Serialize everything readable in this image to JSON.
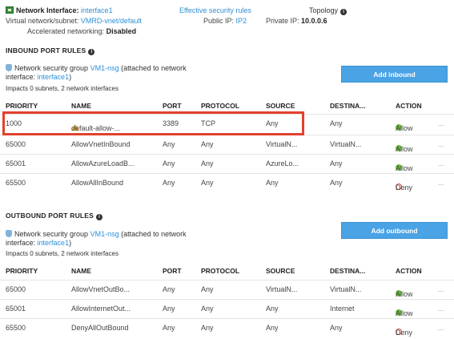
{
  "header": {
    "title_label": "Network Interface:",
    "interface_name": "interface1",
    "effective_rules_link": "Effective security rules",
    "topology_label": "Topology",
    "vnet_label": "Virtual network/subnet:",
    "vnet_value": "VMRD-vnet/default",
    "public_ip_label": "Public IP:",
    "public_ip_value": "IP2",
    "private_ip_label": "Private IP:",
    "private_ip_value": "10.0.0.6",
    "accel_label": "Accelerated networking:",
    "accel_value": "Disabled"
  },
  "inbound": {
    "title": "INBOUND PORT RULES",
    "nsg_prefix": "Network security group",
    "nsg_name": "VM1-nsg",
    "nsg_attached": "(attached to network",
    "nsg_interface_prefix": "interface:",
    "nsg_interface": "interface1",
    "nsg_close": ")",
    "impacts": "Impacts 0 subnets, 2 network interfaces",
    "add_button": "Add inbound",
    "columns": [
      "PRIORITY",
      "NAME",
      "PORT",
      "PROTOCOL",
      "SOURCE",
      "DESTINA...",
      "ACTION"
    ],
    "rows": [
      {
        "priority": "1000",
        "name": "default-allow-...",
        "port": "3389",
        "protocol": "TCP",
        "source": "Any",
        "destination": "Any",
        "action": "Allow",
        "more": "...",
        "warning": true
      },
      {
        "priority": "65000",
        "name": "AllowVnetInBound",
        "port": "Any",
        "protocol": "Any",
        "source": "VirtualN...",
        "destination": "VirtualN...",
        "action": "Allow",
        "more": "..."
      },
      {
        "priority": "65001",
        "name": "AllowAzureLoadB...",
        "port": "Any",
        "protocol": "Any",
        "source": "AzureLo...",
        "destination": "Any",
        "action": "Allow",
        "more": "..."
      },
      {
        "priority": "65500",
        "name": "AllowAllInBound",
        "port": "Any",
        "protocol": "Any",
        "source": "Any",
        "destination": "Any",
        "action": "Deny",
        "more": "..."
      }
    ]
  },
  "outbound": {
    "title": "OUTBOUND PORT RULES",
    "nsg_prefix": "Network security group",
    "nsg_name": "VM1-nsg",
    "nsg_attached": "(attached to network",
    "nsg_interface_prefix": "interface:",
    "nsg_interface": "interface1",
    "nsg_close": ")",
    "impacts": "Impacts 0 subnets, 2 network interfaces",
    "add_button": "Add outbound",
    "columns": [
      "PRIORITY",
      "NAME",
      "PORT",
      "PROTOCOL",
      "SOURCE",
      "DESTINA...",
      "ACTION"
    ],
    "rows": [
      {
        "priority": "65000",
        "name": "AllowVnetOutBo...",
        "port": "Any",
        "protocol": "Any",
        "source": "VirtualN...",
        "destination": "VirtualN...",
        "action": "Allow",
        "more": "..."
      },
      {
        "priority": "65001",
        "name": "AllowInternetOut...",
        "port": "Any",
        "protocol": "Any",
        "source": "Any",
        "destination": "Internet",
        "action": "Allow",
        "more": "..."
      },
      {
        "priority": "65500",
        "name": "DenyAllOutBound",
        "port": "Any",
        "protocol": "Any",
        "source": "Any",
        "destination": "Any",
        "action": "Deny",
        "more": "..."
      }
    ]
  },
  "colors": {
    "accent": "#4aa3e4",
    "link": "#2e8fd6",
    "highlight": "#e2412e",
    "allow": "#6cbf3a",
    "deny": "#d9432b",
    "warning": "#e8a21f"
  }
}
